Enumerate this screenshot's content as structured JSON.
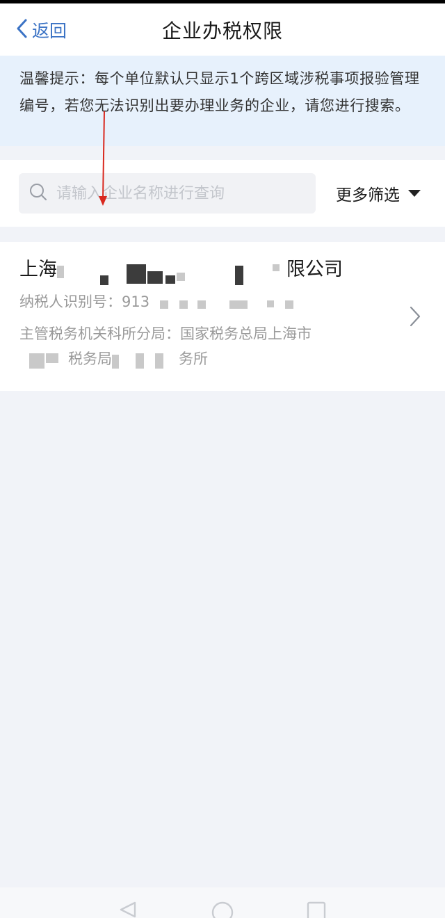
{
  "nav": {
    "back_label": "返回",
    "title": "企业办税权限"
  },
  "notice": {
    "text": "温馨提示：每个单位默认只显示1个跨区域涉税事项报验管理编号，若您无法识别出要办理业务的企业，请您进行搜索。"
  },
  "search": {
    "placeholder": "请输入企业名称进行查询",
    "value": "",
    "filter_label": "更多筛选"
  },
  "company": {
    "name_prefix": "上海",
    "name_suffix": "限公司",
    "tax_id_label": "纳税人识别号：",
    "tax_id_visible": "913",
    "office_label": "主管税务机关科所分局：",
    "office_line1_visible": "国家税务总局上海市",
    "office_line2_a": "税务局",
    "office_line2_b": "务所"
  },
  "colors": {
    "accent": "#3b73c5",
    "notice_bg": "#e7f1fc",
    "page_bg": "#f1f3f8",
    "annotation": "#d9281e"
  },
  "icons": {
    "back": "chevron-left-icon",
    "search": "search-icon",
    "filter": "caret-down-icon",
    "row": "chevron-right-icon",
    "nav_back": "triangle-back-icon",
    "nav_home": "circle-home-icon",
    "nav_recent": "square-recent-icon"
  }
}
